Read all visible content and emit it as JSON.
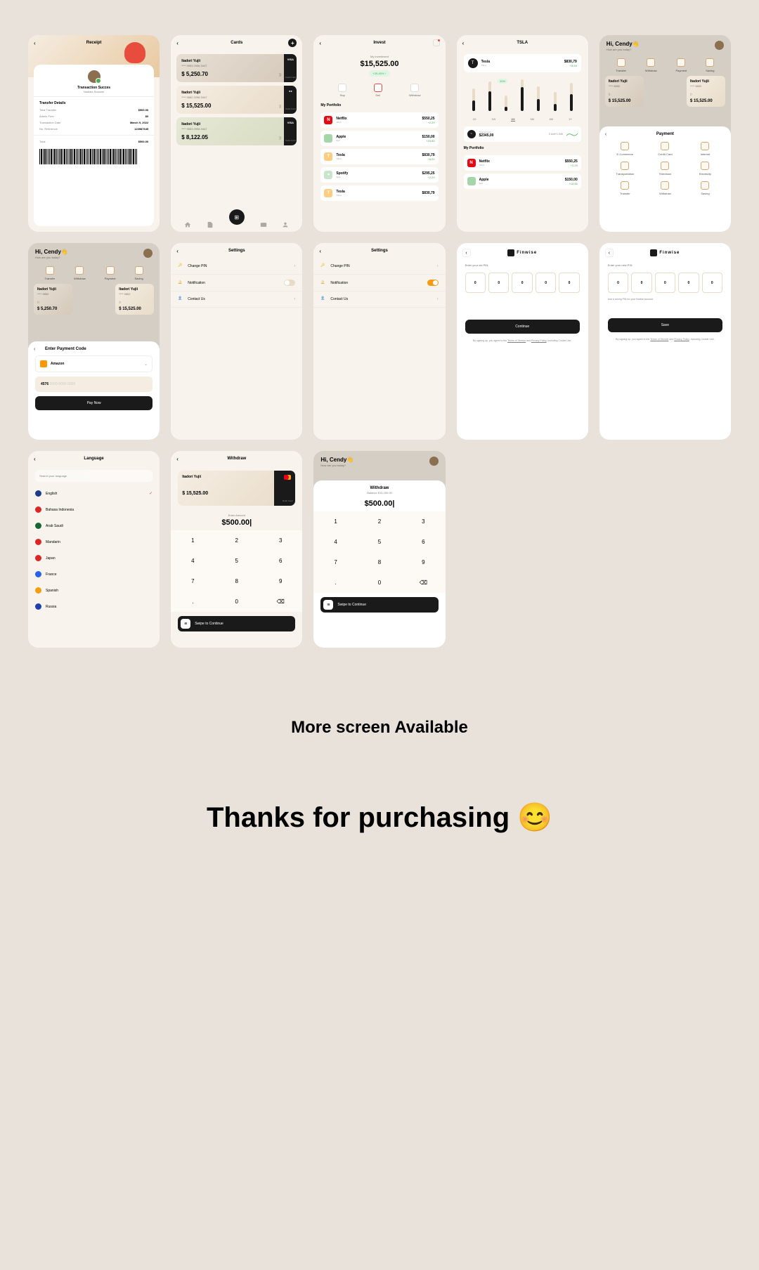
{
  "footer": {
    "more": "More screen Available",
    "thanks": "Thanks for purchasing 😊"
  },
  "receipt": {
    "title": "Receipt",
    "success": "Transaction Succes",
    "user": "Nadiaia Susanto",
    "section": "Transfer Details",
    "rows": [
      {
        "l": "Total Transfer",
        "r": "$500.00"
      },
      {
        "l": "Admin Free",
        "r": "$0"
      },
      {
        "l": "Transaction Date",
        "r": "March 9, 2022"
      },
      {
        "l": "No. Reference",
        "r": "123987645"
      }
    ],
    "total_l": "Total",
    "total_r": "$500.00"
  },
  "cards": {
    "title": "Cards",
    "items": [
      {
        "name": "Itadori Yujii",
        "num": "**** 9953 2906 3447",
        "amt": "$ 5,250.70",
        "logo": "VISA",
        "label": "Credit Card"
      },
      {
        "name": "Itadori Yujii",
        "num": "**** 9662 2296 3447",
        "amt": "$ 15,525.00",
        "logo": "●●",
        "label": "Debit Card"
      },
      {
        "name": "Itadori Yujii",
        "num": "**** 9953 2906 3447",
        "amt": "$ 8,122.05",
        "logo": "VISA",
        "label": "Debit Card"
      }
    ]
  },
  "invest": {
    "title": "Invest",
    "sub": "My Investment",
    "amt": "$15,525.00",
    "badge": "+29-40% ↑",
    "actions": [
      "Buy",
      "Sell",
      "Withdraw"
    ],
    "portfolio_lbl": "My Portfolio",
    "items": [
      {
        "icon": "N",
        "bg": "#e50914",
        "name": "Netflix",
        "sub": "NFLX",
        "amt": "$550,25",
        "diff": "+2.29"
      },
      {
        "icon": "",
        "bg": "#a5d6a7",
        "name": "Apple",
        "sub": "Apll",
        "amt": "$150,00",
        "diff": "+15,85"
      },
      {
        "icon": "T",
        "bg": "#ffcc80",
        "name": "Tesla",
        "sub": "TSLA",
        "amt": "$830,79",
        "diff": "+8,20"
      },
      {
        "icon": "●",
        "bg": "#c8e6c9",
        "name": "Spotify",
        "sub": "Spot",
        "amt": "$295,25",
        "diff": "+2.29"
      },
      {
        "icon": "T",
        "bg": "#ffcc80",
        "name": "Tesla",
        "sub": "TSLA",
        "amt": "$830,79",
        "diff": ""
      }
    ]
  },
  "tsla": {
    "title": "TSLA",
    "name": "Tesla",
    "sub": "TSLA",
    "price": "$830,79",
    "diff": "+8,59",
    "chart": {
      "bars": [
        65,
        85,
        45,
        90,
        70,
        55,
        80
      ],
      "fills": [
        45,
        65,
        25,
        75,
        50,
        35,
        60
      ],
      "dot": "30%"
    },
    "times": [
      "1D",
      "1W",
      "1M",
      "3M",
      "6M",
      "1Y"
    ],
    "val_lbl": "Total amount",
    "val_amt": "$2345,00",
    "val_unit": "0 Unit+1,045",
    "portfolio_lbl": "My Portfolio",
    "items": [
      {
        "icon": "N",
        "bg": "#e50914",
        "name": "Netflix",
        "sub": "NFLX",
        "amt": "$550,25",
        "diff": "+2.29"
      },
      {
        "icon": "",
        "bg": "#a5d6a7",
        "name": "Apple",
        "sub": "Apll",
        "amt": "$150,00",
        "diff": "+15,85"
      }
    ]
  },
  "home": {
    "greet": "Hi, Cendy👋",
    "sub": "How are you today?",
    "actions": [
      "Transfer",
      "Withdraw",
      "Payment",
      "Saving"
    ],
    "minicards": [
      {
        "name": "Itadori Yujii",
        "num": "**** 9852",
        "amt": "$ 5,250.70"
      },
      {
        "name": "Itadori Yujii",
        "num": "**** 9852",
        "amt": "$ 15,525.00"
      }
    ]
  },
  "payment": {
    "title": "Payment",
    "opts": [
      "E-Commerce",
      "Credit Card",
      "Internet",
      "Transportation",
      "Television",
      "Electricity",
      "Transfer",
      "Withdraw",
      "Saving"
    ]
  },
  "paycode": {
    "title": "Enter Payment Code",
    "merchant": "Amazon",
    "code_filled": "4576",
    "code_empty": " 0000-0000-0000",
    "btn": "Pay Now"
  },
  "settings": {
    "title": "Settings",
    "items": [
      {
        "l": "Change PIN"
      },
      {
        "l": "Notification"
      },
      {
        "l": "Contact Us"
      }
    ]
  },
  "pin": {
    "brand": "Finwise",
    "old_lbl": "Enter your old PIN",
    "new_lbl": "Enter your new PIN",
    "digits": [
      "0",
      "0",
      "0",
      "0",
      "0"
    ],
    "note": "Use a strong PIN for your finwise account",
    "btn_c": "Continue",
    "btn_s": "Save",
    "terms_a": "By signing up, you agree to the ",
    "terms_b": "Terms of Service",
    "terms_c": " and ",
    "terms_d": "Privacy Policy",
    "terms_e": ", Including Cookie Use."
  },
  "lang": {
    "title": "Language",
    "search": "Search your language",
    "items": [
      {
        "n": "English",
        "c": "#1e3a8a",
        "sel": true
      },
      {
        "n": "Bahasa Indonesia",
        "c": "#dc2626"
      },
      {
        "n": "Arab Saudi",
        "c": "#166534"
      },
      {
        "n": "Mandarin",
        "c": "#dc2626"
      },
      {
        "n": "Japan",
        "c": "#dc2626"
      },
      {
        "n": "France",
        "c": "#2563eb"
      },
      {
        "n": "Spanish",
        "c": "#f59e0b"
      },
      {
        "n": "Russia",
        "c": "#1e40af"
      }
    ]
  },
  "withdraw": {
    "title": "Withdraw",
    "card_name": "Itadori Yujii",
    "card_amt": "$ 15,525.00",
    "card_lbl": "Debit Card",
    "enter": "Enter Amount",
    "amt": "$500.00|",
    "balance": "Balance $15,250.00",
    "keys": [
      "1",
      "2",
      "3",
      "4",
      "5",
      "6",
      "7",
      "8",
      "9",
      ".",
      "0",
      "⌫"
    ],
    "swipe": "Swipe to Continue"
  }
}
